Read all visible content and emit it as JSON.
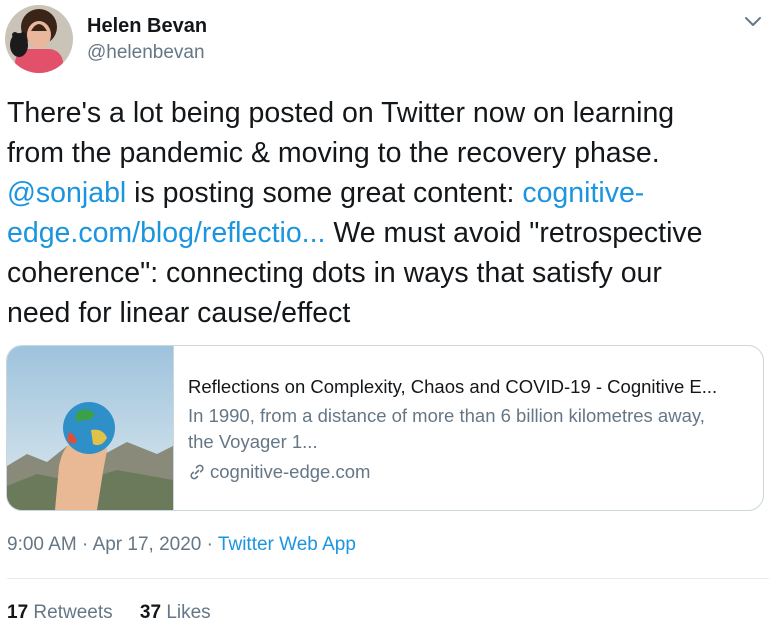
{
  "author": {
    "name": "Helen Bevan",
    "handle": "@helenbevan"
  },
  "tweet": {
    "lines": [
      [
        "There's a lot being posted on Twitter now on learning"
      ],
      [
        "from the pandemic & moving to the recovery phase."
      ],
      [
        "@sonjabl",
        " is posting some great content: ",
        "cognitive-"
      ],
      [
        "edge.com/blog/reflectio...",
        " We must avoid \"retrospective"
      ],
      [
        "coherence\": connecting dots in ways that satisfy our"
      ],
      [
        "need for linear cause/effect"
      ]
    ]
  },
  "card": {
    "title": "Reflections on Complexity, Chaos and COVID-19 - Cognitive E...",
    "description_line1": "In 1990, from a distance of more than 6 billion kilometres away,",
    "description_line2": "the Voyager 1...",
    "domain": "cognitive-edge.com"
  },
  "meta": {
    "time": "9:00 AM",
    "separator1": " · ",
    "date": "Apr 17, 2020",
    "separator2": " · ",
    "app": "Twitter Web App"
  },
  "stats": {
    "retweets_count": "17",
    "retweets_label": "Retweets",
    "likes_count": "37",
    "likes_label": "Likes"
  },
  "colors": {
    "link": "#1b95e0",
    "secondary_text": "#657786",
    "primary_text": "#14171a",
    "border": "#ccd6dd"
  },
  "icons": {
    "more": "chevron-down-icon",
    "domain": "link-icon"
  }
}
